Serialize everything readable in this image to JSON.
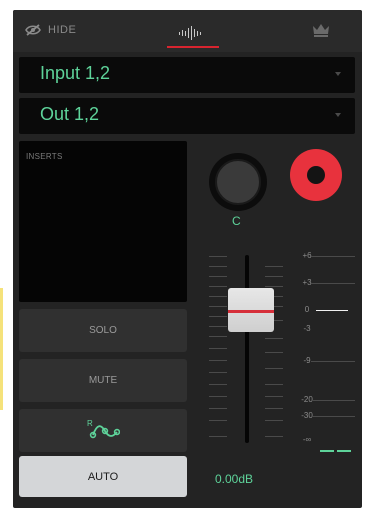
{
  "header": {
    "hide_label": "HIDE",
    "icons": [
      "hide-eye-icon",
      "waveform-icon",
      "crown-icon"
    ]
  },
  "input": {
    "value": "Input 1,2"
  },
  "output": {
    "value": "Out 1,2"
  },
  "inserts": {
    "label": "INSERTS"
  },
  "buttons": {
    "solo": "SOLO",
    "mute": "MUTE",
    "auto": "AUTO",
    "automation_curve_label": "R"
  },
  "pan": {
    "value": "C"
  },
  "fader": {
    "scale_labels": [
      "+6",
      "+3",
      "0",
      "-3",
      "-9",
      "-20",
      "-30",
      "-∞"
    ],
    "level_db": "0.00dB"
  },
  "colors": {
    "accent_green": "#5ed39a",
    "record_red": "#e8323d",
    "panel": "#232323",
    "active_button": "#d4d6d8"
  }
}
